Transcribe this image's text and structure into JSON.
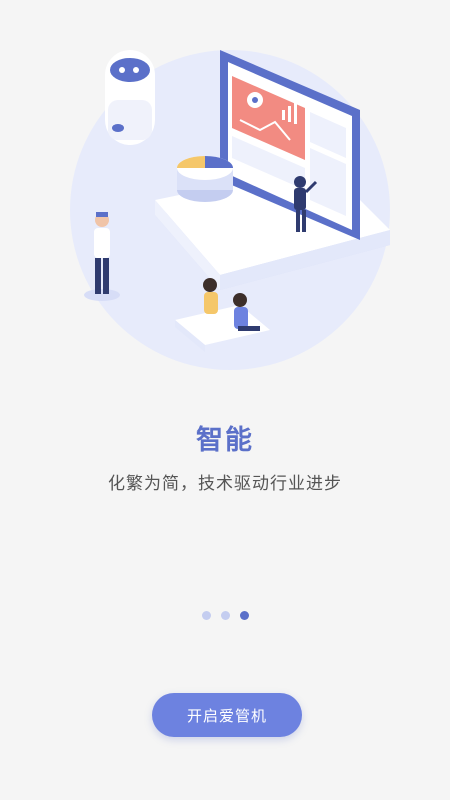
{
  "onboarding": {
    "title": "智能",
    "subtitle": "化繁为简，技术驱动行业进步",
    "page_indicator": {
      "total": 3,
      "active_index": 2
    },
    "start_button_label": "开启爱管机",
    "illustration_icon": "smart-analytics-illustration"
  },
  "colors": {
    "background": "#f5f5f5",
    "accent": "#5b70c9",
    "button": "#6d82e0",
    "dot_inactive": "#c4cdf0"
  }
}
